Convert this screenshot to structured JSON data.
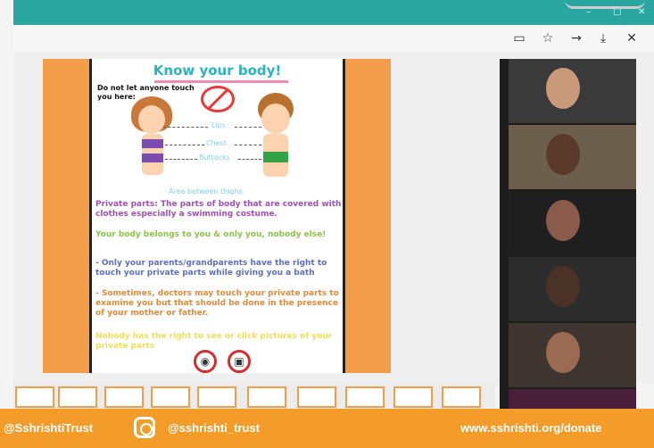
{
  "slide": {
    "title": "Know your body!",
    "warning": "Do not let anyone touch you here:",
    "parts": [
      "Lips",
      "Chest",
      "Buttocks"
    ],
    "area": "Area between thighs",
    "paragraphs": [
      "Private parts: The parts of body that are covered with clothes especially a swimming costume.",
      "Your body belongs to you & only you, nobody else!",
      "- Only your parents/grandparents have the right to touch your private parts while giving you a bath",
      "- Sometimes, doctors may touch your private parts to examine you but that should be done in the presence of your mother or father.",
      "Nobody has the right to see or click pictures of your private parts"
    ]
  },
  "banner": {
    "left": "@SshrishtiTrust",
    "handle": "@sshrishti_trust",
    "url": "www.sshrishti.org/donate"
  },
  "colors": {
    "accent": "#f39c2a",
    "titlebar": "#2aa6a0"
  }
}
